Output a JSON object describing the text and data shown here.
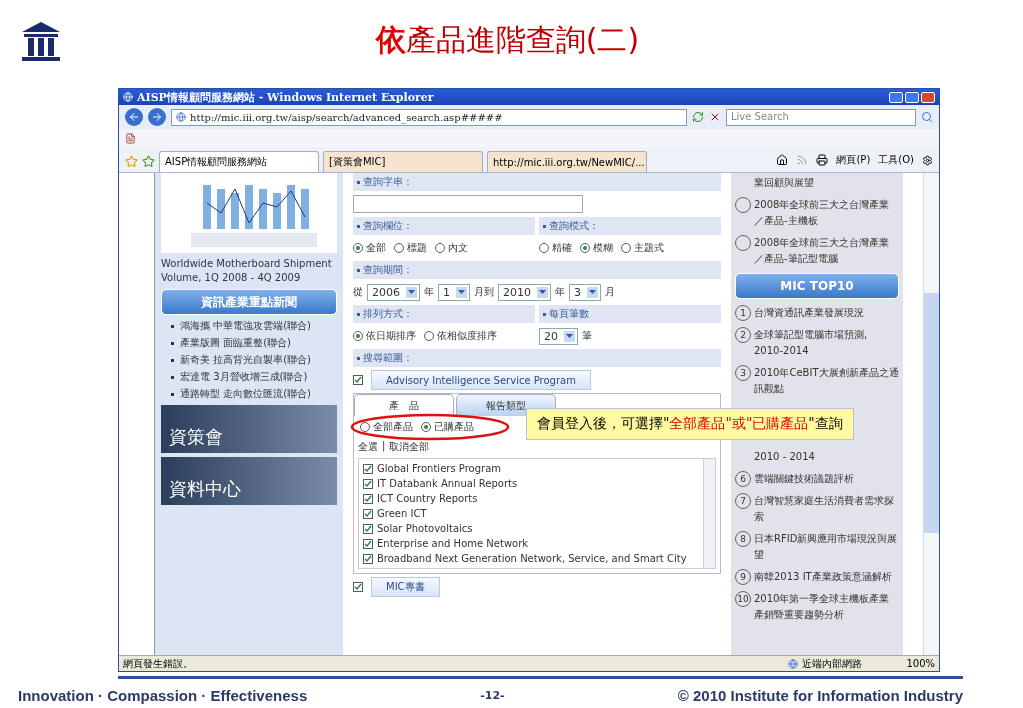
{
  "slide": {
    "title_lead": "依",
    "title_rest": "產品進階查詢(二)",
    "motto": "Innovation · Compassion · Effectiveness",
    "page_number": "-12-",
    "copyright": "© 2010 Institute for Information Industry"
  },
  "browser": {
    "title": "AISP情報顧問服務網站 - Windows Internet Explorer",
    "url": "http://mic.iii.org.tw/aisp/search/advanced_search.asp#####",
    "search_placeholder": "Live Search",
    "tabs": [
      {
        "label": "AISP情報顧問服務網站",
        "selected": true
      },
      {
        "label": "[資策會MIC]",
        "selected": false
      },
      {
        "label": "http://mic.iii.org.tw/NewMIC/...",
        "selected": false
      }
    ],
    "toolbar": [
      "網頁(P)",
      "工具(O)"
    ],
    "status": "網頁發生錯誤。",
    "zone": "近端內部網路",
    "zoom": "100%"
  },
  "left": {
    "chart_caption": "Worldwide Motherboard Shipment Volume, 1Q 2008 - 4Q 2009",
    "news_button": "資訊產業重點新聞",
    "news": [
      "鴻海攜 中華電強攻雲端(聯合)",
      "產業版圖 面臨重整(聯合)",
      "新奇美 拉高背光自製率(聯合)",
      "宏達電 3月營收增三成(聯合)",
      "通路轉型 走向數位匯流(聯合)"
    ],
    "banners": [
      "資策會",
      "資料中心"
    ]
  },
  "form": {
    "query_header": "查詢字串：",
    "field_header": "查詢欄位：",
    "mode_header": "查詢模式：",
    "field_options": [
      {
        "label": "全部",
        "selected": true
      },
      {
        "label": "標題",
        "selected": false
      },
      {
        "label": "內文",
        "selected": false
      }
    ],
    "mode_options": [
      {
        "label": "精確",
        "selected": false
      },
      {
        "label": "模糊",
        "selected": true
      },
      {
        "label": "主題式",
        "selected": false
      }
    ],
    "period_header": "查詢期間：",
    "period": [
      {
        "kind": "text",
        "text": "從"
      },
      {
        "kind": "select",
        "text": "2006"
      },
      {
        "kind": "text",
        "text": "年"
      },
      {
        "kind": "select",
        "text": "1"
      },
      {
        "kind": "text",
        "text": "月到"
      },
      {
        "kind": "select",
        "text": "2010"
      },
      {
        "kind": "text",
        "text": "年"
      },
      {
        "kind": "select",
        "text": "3"
      },
      {
        "kind": "text",
        "text": "月"
      }
    ],
    "sort_header": "排列方式：",
    "per_page_header": "每頁筆數",
    "sort_options": [
      {
        "label": "依日期排序",
        "selected": true
      },
      {
        "label": "依相似度排序",
        "selected": false
      }
    ],
    "per_page": "20",
    "per_page_unit": "筆",
    "scope_header": "搜尋範圍：",
    "program": {
      "label": "Advisory Intelligence Service Program",
      "checked": true
    },
    "panel_tabs": [
      {
        "label": "產　品",
        "selected": true
      },
      {
        "label": "報告類型",
        "selected": false
      }
    ],
    "filter_options": [
      {
        "label": "全部產品",
        "selected": false
      },
      {
        "label": "已購產品",
        "selected": true
      }
    ],
    "select_all": "全選",
    "separator": "|",
    "clear_all": "取消全部",
    "items": [
      {
        "label": "Global Frontiers Program",
        "checked": true
      },
      {
        "label": "IT Databank Annual Reports",
        "checked": true
      },
      {
        "label": "ICT Country Reports",
        "checked": true
      },
      {
        "label": "Green ICT",
        "checked": true
      },
      {
        "label": "Solar Photovoltaics",
        "checked": true
      },
      {
        "label": "Enterprise and Home Network",
        "checked": true
      },
      {
        "label": "Broadband Next Generation Network, Service, and Smart City",
        "checked": true
      }
    ],
    "book": {
      "label": "MIC專書",
      "checked": true
    }
  },
  "callout": [
    {
      "text": "會員登入後，可選擇\"",
      "highlight": false
    },
    {
      "text": "全部產品\"或\"已購產品",
      "highlight": true
    },
    {
      "text": "\"查詢",
      "highlight": false
    }
  ],
  "right": {
    "top_fragment": "業回顧與展望",
    "reports": [
      "2008年全球前三大之台灣產業／產品-主機板",
      "2008年全球前三大之台灣產業／產品-筆記型電腦"
    ],
    "top10_button": "MIC  TOP10",
    "top10": [
      {
        "kind": "item",
        "number": "1",
        "text": "台灣資通訊產業發展現況"
      },
      {
        "kind": "item",
        "number": "2",
        "text": "全球筆記型電腦市場預測, 2010-2014"
      },
      {
        "kind": "item",
        "number": "3",
        "text": "2010年CeBIT大展創新產品之通訊觀點"
      },
      {
        "kind": "continuation",
        "text": "2010 - 2014"
      },
      {
        "kind": "item",
        "number": "6",
        "text": "雲端關鍵技術議題評析"
      },
      {
        "kind": "item",
        "number": "7",
        "text": "台灣智慧家庭生活消費者需求探索"
      },
      {
        "kind": "item",
        "number": "8",
        "text": "日本RFID新興應用市場現況與展望"
      },
      {
        "kind": "item",
        "number": "9",
        "text": "南韓2013 IT產業政策意涵解析"
      },
      {
        "kind": "item",
        "number": "10",
        "text": "2010年第一季全球主機板產業產銷暨重要趨勢分析"
      }
    ]
  }
}
